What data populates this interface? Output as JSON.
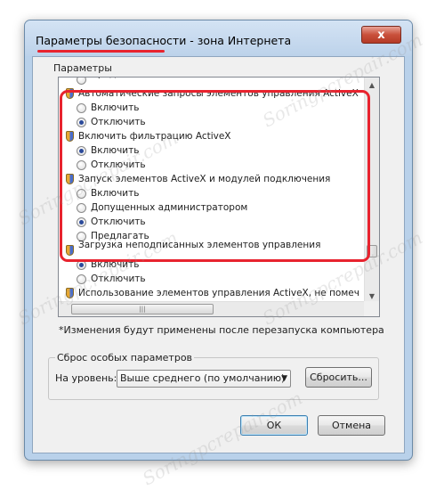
{
  "window": {
    "title": "Параметры безопасности - зона Интернета",
    "close_label": "x"
  },
  "settings": {
    "group_label": "Параметры",
    "rows": [
      {
        "kind": "option",
        "label": "Предлагать",
        "checked": false,
        "clipped": true
      },
      {
        "kind": "category",
        "label": "Автоматические запросы элементов управления ActiveX"
      },
      {
        "kind": "option",
        "label": "Включить",
        "checked": false
      },
      {
        "kind": "option",
        "label": "Отключить",
        "checked": true
      },
      {
        "kind": "category",
        "label": "Включить фильтрацию ActiveX"
      },
      {
        "kind": "option",
        "label": "Включить",
        "checked": true
      },
      {
        "kind": "option",
        "label": "Отключить",
        "checked": false
      },
      {
        "kind": "category",
        "label": "Запуск элементов ActiveX и модулей подключения"
      },
      {
        "kind": "option",
        "label": "Включить",
        "checked": false
      },
      {
        "kind": "option",
        "label": "Допущенных администратором",
        "checked": false
      },
      {
        "kind": "option",
        "label": "Отключить",
        "checked": true
      },
      {
        "kind": "option",
        "label": "Предлагать",
        "checked": false
      },
      {
        "kind": "category",
        "label": "Загрузка неподписанных элементов управления",
        "clipped": true
      },
      {
        "kind": "option",
        "label": "Включить",
        "checked": true
      },
      {
        "kind": "option",
        "label": "Отключить",
        "checked": false
      },
      {
        "kind": "category",
        "label": "Использование элементов управления ActiveX, не помеч"
      }
    ],
    "scroll_up": "▲",
    "scroll_down": "▼",
    "hscroll_grip": "|||"
  },
  "note": "*Изменения будут применены после перезапуска компьютера",
  "reset": {
    "group_label": "Сброс особых параметров",
    "level_label": "На уровень:",
    "level_value": "Выше среднего (по умолчанию)",
    "combo_arrow": "▼",
    "reset_button": "Сбросить..."
  },
  "buttons": {
    "ok": "ОК",
    "cancel": "Отмена"
  },
  "watermark": "Soringpcrepair.com",
  "colors": {
    "highlight": "#e8232e",
    "radio_dot": "#2b4a9a"
  }
}
